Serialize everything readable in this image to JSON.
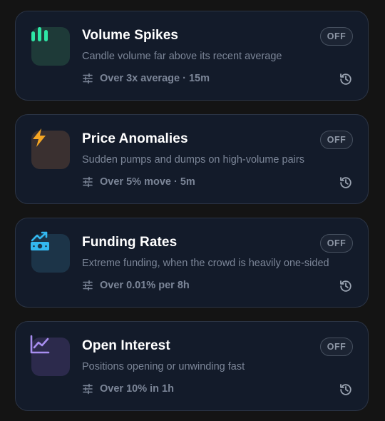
{
  "cards": [
    {
      "title": "Volume Spikes",
      "description": "Candle volume far above its recent average",
      "meta": "Over 3x average · 15m",
      "toggle": "OFF",
      "icon": "bar-chart-icon",
      "accent": "#2ee6a6",
      "tile": "#1e3a38"
    },
    {
      "title": "Price Anomalies",
      "description": "Sudden pumps and dumps on high-volume pairs",
      "meta": "Over 5% move · 5m",
      "toggle": "OFF",
      "icon": "lightning-bolt-icon",
      "accent": "#f5a623",
      "tile": "#3a3030"
    },
    {
      "title": "Funding Rates",
      "description": "Extreme funding, when the crowd is heavily one-sided",
      "meta": "Over 0.01% per 8h",
      "toggle": "OFF",
      "icon": "trending-money-icon",
      "accent": "#33b8f0",
      "tile": "#1c3448"
    },
    {
      "title": "Open Interest",
      "description": "Positions opening or unwinding fast",
      "meta": "Over 10% in 1h",
      "toggle": "OFF",
      "icon": "line-chart-icon",
      "accent": "#a88ef0",
      "tile": "#2c2a4c"
    }
  ]
}
